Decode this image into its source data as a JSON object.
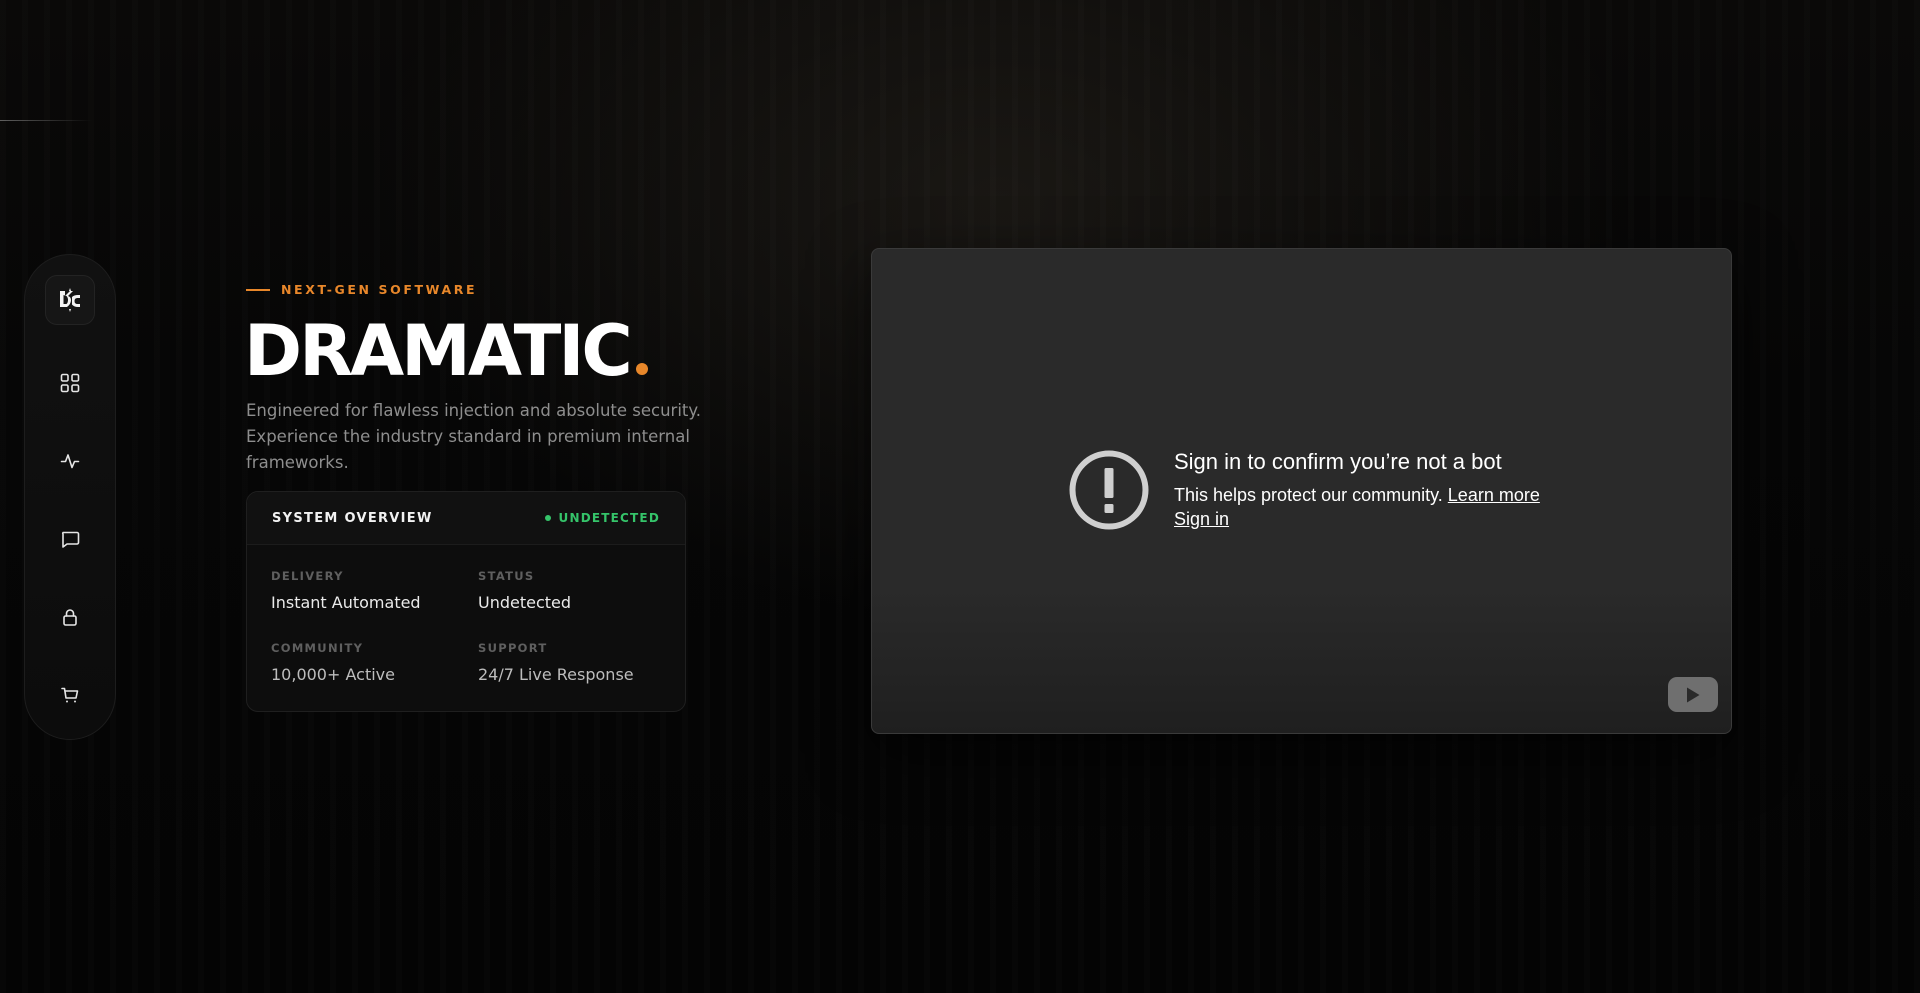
{
  "sidebar": {
    "logo": {
      "icon": "dc-logo-icon"
    },
    "items": [
      {
        "icon": "grid-icon"
      },
      {
        "icon": "activity-icon"
      },
      {
        "icon": "chat-icon"
      },
      {
        "icon": "lock-icon"
      },
      {
        "icon": "cart-icon"
      }
    ]
  },
  "hero": {
    "eyebrow": "NEXT-GEN SOFTWARE",
    "title": "DRAMATIC",
    "description": "Engineered for flawless injection and absolute security. Experience the industry standard in premium internal frameworks."
  },
  "overview": {
    "title": "SYSTEM OVERVIEW",
    "status": "UNDETECTED",
    "stats": [
      {
        "label": "DELIVERY",
        "value": "Instant Automated"
      },
      {
        "label": "STATUS",
        "value": "Undetected"
      },
      {
        "label": "COMMUNITY",
        "value": "10,000+ Active"
      },
      {
        "label": "SUPPORT",
        "value": "24/7 Live Response"
      }
    ]
  },
  "video": {
    "title": "Sign in to confirm you’re not a bot",
    "body": "This helps protect our community.",
    "learn_more": "Learn more",
    "sign_in": "Sign in"
  },
  "colors": {
    "accent": "#e8872a",
    "status_green": "#35c46a",
    "background": "#050505"
  }
}
